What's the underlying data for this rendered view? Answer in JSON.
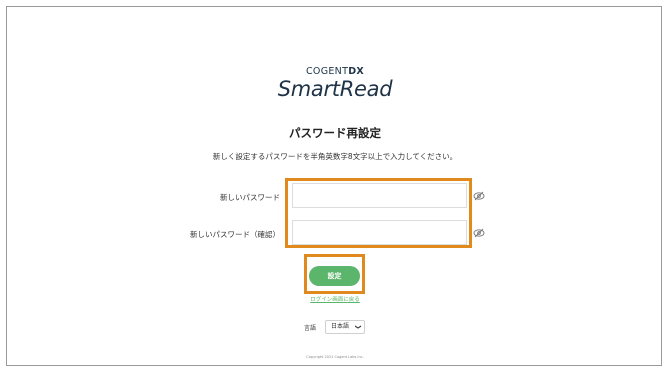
{
  "brand": {
    "company": "COGENT",
    "company_suffix": "DX",
    "product": "SmartRead"
  },
  "page": {
    "title": "パスワード再設定",
    "description": "新しく設定するパスワードを半角英数字8文字以上で入力してください。"
  },
  "form": {
    "new_password_label": "新しいパスワード",
    "new_password_value": "",
    "confirm_password_label": "新しいパスワード（確認）",
    "confirm_password_value": "",
    "visibility_icon": "eye-off-icon",
    "submit_label": "設定",
    "submit_color": "#5bb56a",
    "back_link": "ログイン画面に戻る"
  },
  "language": {
    "label": "言語",
    "selected": "日本語"
  },
  "footer": {
    "copyright": "Copyright 2021 Cogent Labs Inc."
  },
  "highlight_color": "#e08a1e"
}
